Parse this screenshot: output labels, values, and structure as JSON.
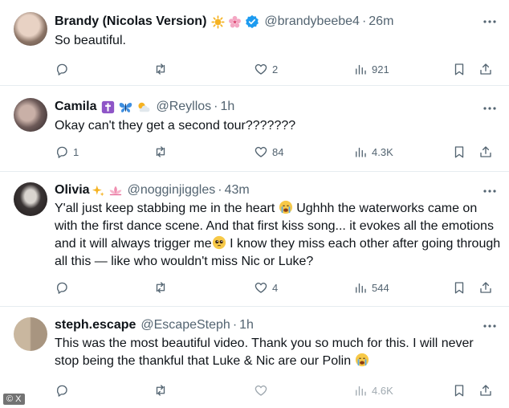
{
  "tweets": [
    {
      "name": "Brandy (Nicolas Version)",
      "handle": "@brandybeebe4",
      "separator": "·",
      "time": "26m",
      "text": "So beautiful.",
      "replies": "",
      "likes": "2",
      "views": "921"
    },
    {
      "name": "Camila",
      "handle": "@Reyllos",
      "separator": "·",
      "time": "1h",
      "text": "Okay can't they get a second tour???????",
      "replies": "1",
      "likes": "84",
      "views": "4.3K"
    },
    {
      "name": "Olivia",
      "handle": "@nogginjiggles",
      "separator": "·",
      "time": "43m",
      "text_p1": "Y'all just keep stabbing me in the heart ",
      "text_p2": " Ughhh the waterworks came on with the first dance scene. And that first kiss song... it evokes all the emotions and it will always trigger me",
      "text_p3": " I know they miss each other after going through all this — like who wouldn't miss Nic or Luke?",
      "replies": "",
      "likes": "4",
      "views": "544"
    },
    {
      "name": "steph.escape",
      "handle": "@EscapeSteph",
      "separator": "·",
      "time": "1h",
      "text_p1": "This was the most beautiful video. Thank you so much for this. I will never stop being the thankful that Luke &  Nic are our Polin ",
      "replies": "",
      "likes": "",
      "views": "4.6K"
    }
  ],
  "watermark": "© X",
  "colors": {
    "text": "#0f1419",
    "muted": "#536471",
    "verified": "#1d9bf0",
    "divider": "#e6ecf0"
  },
  "icons": [
    "reply-icon",
    "retweet-icon",
    "like-icon",
    "views-icon",
    "bookmark-icon",
    "share-icon",
    "more-icon",
    "verified-badge-icon",
    "loudly-crying-face-emoji",
    "pleading-face-emoji"
  ]
}
